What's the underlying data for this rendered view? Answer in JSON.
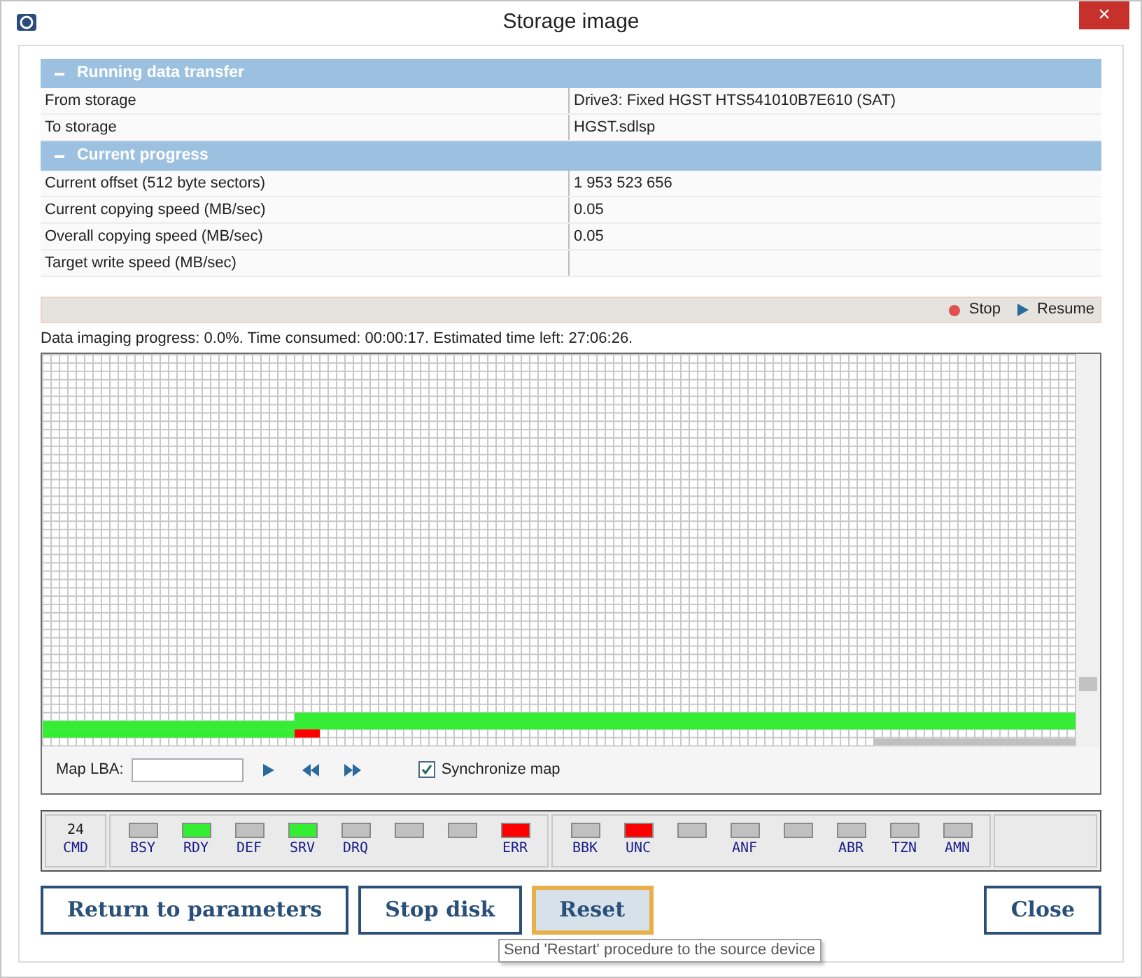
{
  "window": {
    "title": "Storage image",
    "close": "×"
  },
  "sections": [
    {
      "title": "Running data transfer",
      "expanded": true,
      "rows": [
        {
          "label": "From storage",
          "value": "Drive3: Fixed HGST HTS541010B7E610 (SAT)"
        },
        {
          "label": "To storage",
          "value": "HGST.sdlsp"
        }
      ]
    },
    {
      "title": "Current progress",
      "expanded": true,
      "rows": [
        {
          "label": "Current offset (512 byte sectors)",
          "value": "1 953 523 656"
        },
        {
          "label": "Current copying speed (MB/sec)",
          "value": "0.05"
        },
        {
          "label": "Overall copying speed (MB/sec)",
          "value": "0.05"
        },
        {
          "label": "Target write speed (MB/sec)"
        }
      ]
    }
  ],
  "toolbar": [
    "Stop",
    "Resume"
  ],
  "progress_text": "Data imaging progress: 0.0%. Time consumed: 00:00:17. Estimated time left: 27:06:26.",
  "map_controls": {
    "label": "Map LBA:",
    "sync": {
      "label": "Synchronize map",
      "checked": true
    }
  },
  "cmd": {
    "value": "24",
    "label": "CMD"
  },
  "registers": [
    [
      {
        "label": "BSY",
        "color": "#c0c0c0"
      },
      {
        "label": "RDY",
        "color": "#33ee33"
      },
      {
        "label": "DEF",
        "color": "#c0c0c0"
      },
      {
        "label": "SRV",
        "color": "#33ee33"
      },
      {
        "label": "DRQ",
        "color": "#c0c0c0"
      },
      {
        "color": "#c0c0c0"
      },
      {
        "color": "#c0c0c0"
      },
      {
        "label": "ERR",
        "color": "#ff0000"
      }
    ],
    [
      {
        "label": "BBK",
        "color": "#c0c0c0"
      },
      {
        "label": "UNC",
        "color": "#ff0000"
      },
      {
        "color": "#c0c0c0"
      },
      {
        "label": "ANF",
        "color": "#c0c0c0"
      },
      {
        "color": "#c0c0c0"
      },
      {
        "label": "ABR",
        "color": "#c0c0c0"
      },
      {
        "label": "TZN",
        "color": "#c0c0c0"
      },
      {
        "label": "AMN",
        "color": "#c0c0c0"
      }
    ]
  ],
  "buttons": [
    {
      "label": "Return to parameters",
      "selected": false
    },
    {
      "label": "Stop disk",
      "selected": false
    },
    {
      "label": "Reset",
      "selected": true
    }
  ],
  "close_button": "Close",
  "tooltip": "Send 'Restart' procedure to the source device"
}
